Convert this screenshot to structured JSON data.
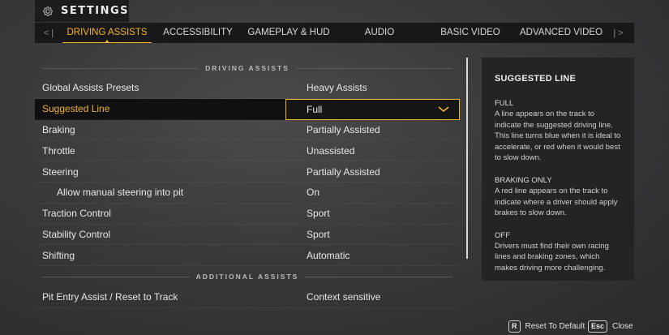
{
  "header": {
    "title": "SETTINGS",
    "icon": "gear-icon"
  },
  "tabs": {
    "left_arrow": "< |",
    "right_arrow": "| >",
    "items": [
      {
        "label": "DRIVING ASSISTS",
        "active": true
      },
      {
        "label": "ACCESSIBILITY",
        "active": false
      },
      {
        "label": "GAMEPLAY & HUD",
        "active": false
      },
      {
        "label": "AUDIO",
        "active": false
      },
      {
        "label": "BASIC VIDEO",
        "active": false
      },
      {
        "label": "ADVANCED VIDEO",
        "active": false
      }
    ]
  },
  "sections": {
    "driving_assists": "DRIVING ASSISTS",
    "additional_assists": "ADDITIONAL ASSISTS"
  },
  "settings": [
    {
      "name": "Global Assists Presets",
      "value": "Heavy Assists"
    },
    {
      "name": "Suggested Line",
      "value": "Full",
      "selected": true
    },
    {
      "name": "Braking",
      "value": "Partially Assisted"
    },
    {
      "name": "Throttle",
      "value": "Unassisted"
    },
    {
      "name": "Steering",
      "value": "Partially Assisted"
    },
    {
      "name": "Allow manual steering into pit",
      "value": "On",
      "indent": true
    },
    {
      "name": "Traction Control",
      "value": "Sport"
    },
    {
      "name": "Stability Control",
      "value": "Sport"
    },
    {
      "name": "Shifting",
      "value": "Automatic"
    }
  ],
  "additional_settings": [
    {
      "name": "Pit Entry Assist / Reset to Track",
      "value": "Context sensitive"
    }
  ],
  "help": {
    "title": "SUGGESTED LINE",
    "blocks": [
      {
        "heading": "FULL",
        "body": "A line appears on the track to indicate the suggested driving line. This line turns blue when it is ideal to accelerate, or red when it would best to slow down."
      },
      {
        "heading": "BRAKING ONLY",
        "body": "A red line appears on the track to indicate where a driver should apply brakes to slow down."
      },
      {
        "heading": "OFF",
        "body": "Drivers must find their own racing lines and braking zones, which makes driving more challenging."
      }
    ]
  },
  "footer": {
    "reset": {
      "key": "R",
      "label": "Reset To Default"
    },
    "close": {
      "key": "Esc",
      "label": "Close"
    }
  },
  "colors": {
    "accent": "#f0b429",
    "panel": "#242426",
    "bar": "#18181a"
  }
}
